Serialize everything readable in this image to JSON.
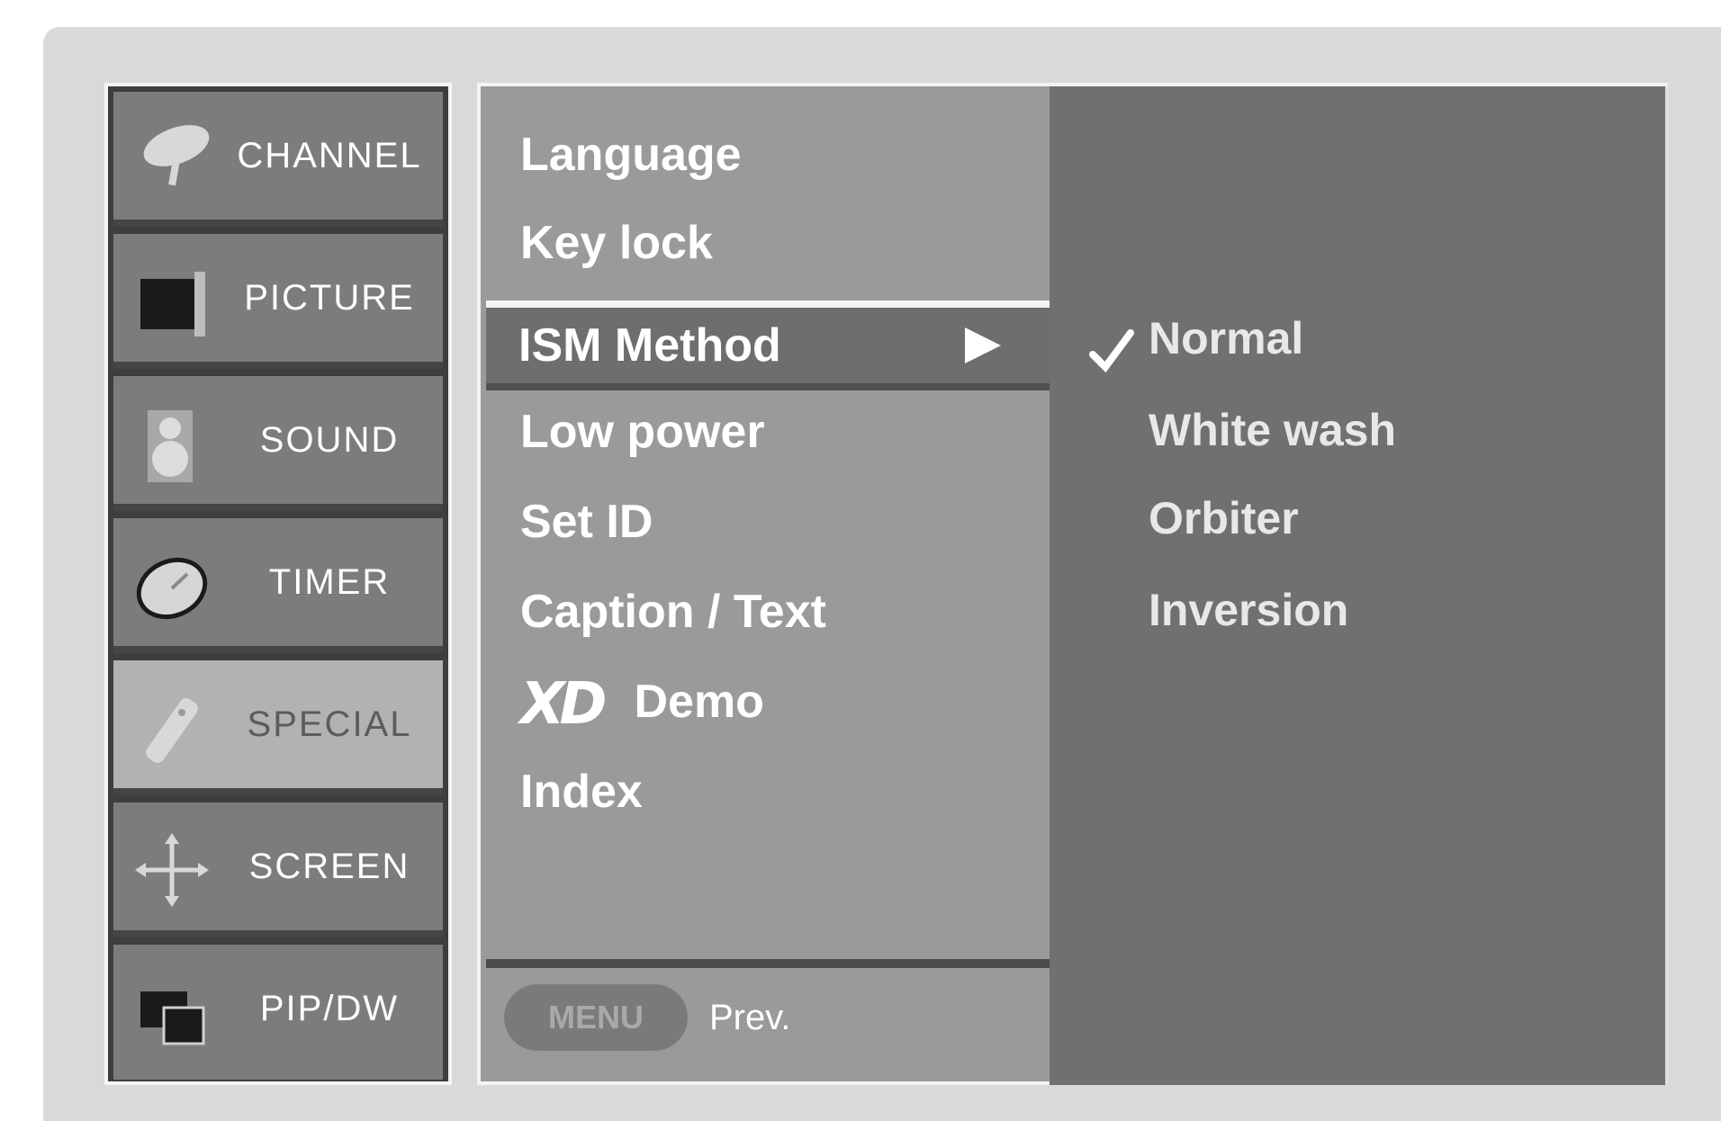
{
  "categories": [
    {
      "label": "CHANNEL",
      "icon": "satellite-dish-icon"
    },
    {
      "label": "PICTURE",
      "icon": "tv-screen-icon"
    },
    {
      "label": "SOUND",
      "icon": "speaker-icon"
    },
    {
      "label": "TIMER",
      "icon": "clock-icon"
    },
    {
      "label": "SPECIAL",
      "icon": "remote-control-icon"
    },
    {
      "label": "SCREEN",
      "icon": "move-arrows-icon"
    },
    {
      "label": "PIP/DW",
      "icon": "pip-windows-icon"
    }
  ],
  "active_category": "SPECIAL",
  "menu": {
    "items": [
      "Language",
      "Key lock",
      "ISM Method",
      "Low power",
      "Set ID",
      "Caption / Text",
      "Demo",
      "Index"
    ],
    "selected": "ISM Method",
    "xd_logo": "XD",
    "footer": {
      "menu_button": "MENU",
      "prev_label": "Prev."
    }
  },
  "submenu": {
    "options": [
      "Normal",
      "White wash",
      "Orbiter",
      "Inversion"
    ],
    "checked": "Normal"
  },
  "colors": {
    "frame": "#d9d9d9",
    "sidebar_bg": "#7c7c7c",
    "active_category_bg": "#b2b2b2",
    "menu_bg": "#9a9a9a",
    "highlight_bg": "#6e6e6e",
    "submenu_bg": "#707070",
    "text": "#ffffff"
  }
}
